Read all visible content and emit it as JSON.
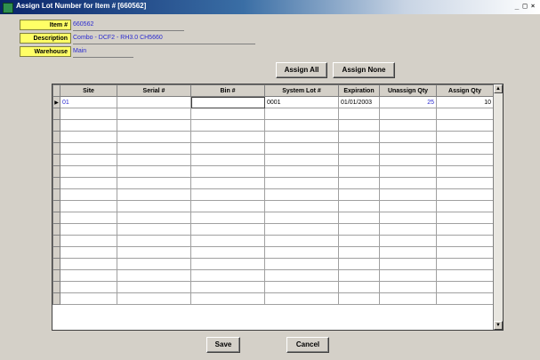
{
  "window": {
    "title": "Assign Lot Number for Item # [660562]",
    "controls": [
      "_",
      "□",
      "×"
    ]
  },
  "header": {
    "item_label": "Item #",
    "item_value": "660562",
    "description_label": "Description",
    "description_value": "Combo - DCF2 - RH3.0 CH5660",
    "warehouse_label": "Warehouse",
    "warehouse_value": "Main"
  },
  "actions": {
    "assign_all": "Assign All",
    "assign_none": "Assign None"
  },
  "grid": {
    "columns": [
      "Site",
      "Serial #",
      "Bin #",
      "System Lot #",
      "Expiration",
      "Unassign Qty",
      "Assign Qty"
    ],
    "rows": [
      {
        "site": "01",
        "serial": "",
        "bin": "",
        "system_lot": "0001",
        "expiration": "01/01/2003",
        "unassign_qty": "25",
        "assign_qty": "10"
      }
    ]
  },
  "footer": {
    "save": "Save",
    "cancel": "Cancel"
  }
}
